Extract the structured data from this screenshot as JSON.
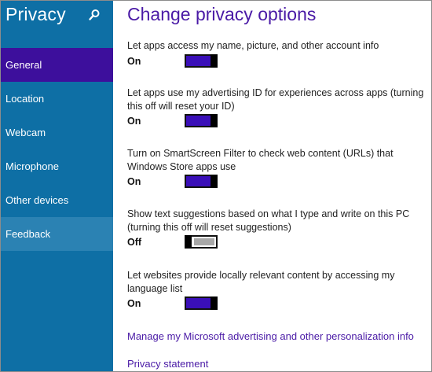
{
  "sidebar": {
    "title": "Privacy",
    "items": [
      {
        "label": "General",
        "active": true
      },
      {
        "label": "Location"
      },
      {
        "label": "Webcam"
      },
      {
        "label": "Microphone"
      },
      {
        "label": "Other devices"
      },
      {
        "label": "Feedback",
        "hover": true
      }
    ]
  },
  "main": {
    "title": "Change privacy options",
    "settings": [
      {
        "description": "Let apps access my name, picture, and other account info",
        "state": "On",
        "on": true
      },
      {
        "description": "Let apps use my advertising ID for experiences across apps (turning this off will reset your ID)",
        "state": "On",
        "on": true
      },
      {
        "description": "Turn on SmartScreen Filter to check web content (URLs) that Windows Store apps use",
        "state": "On",
        "on": true
      },
      {
        "description": "Show text suggestions based on what I type and write on this PC (turning this off will reset suggestions)",
        "state": "Off",
        "on": false
      },
      {
        "description": "Let websites provide locally relevant content by accessing my language list",
        "state": "On",
        "on": true
      }
    ],
    "links": [
      {
        "label": "Manage my Microsoft advertising and other personalization info"
      },
      {
        "label": "Privacy statement"
      }
    ]
  },
  "colors": {
    "sidebar": "#0e6fa5",
    "nav_active": "#3d0f9c",
    "nav_hover": "#2b82b3",
    "accent": "#4a1aa6",
    "toggle_on": "#3a0fb8",
    "toggle_off": "#a7a7a7"
  },
  "icons": {
    "search": "search-icon"
  }
}
